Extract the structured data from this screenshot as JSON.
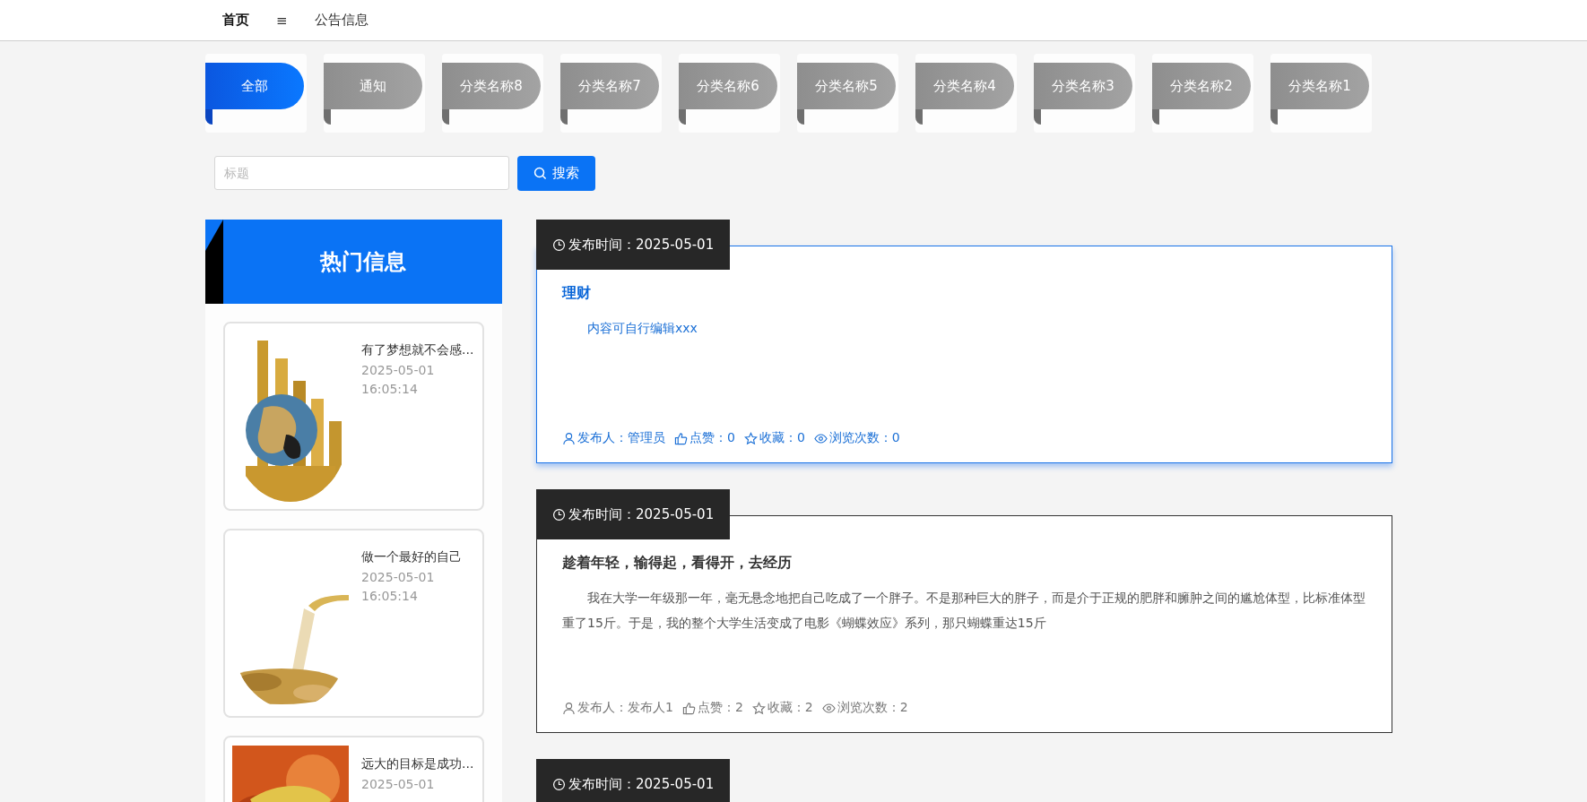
{
  "nav": {
    "items": [
      {
        "label": "首页",
        "selected": true
      },
      {
        "label": "≡",
        "selected": false
      },
      {
        "label": "公告信息",
        "selected": false
      }
    ]
  },
  "categories": [
    {
      "label": "全部",
      "selected": true
    },
    {
      "label": "通知",
      "selected": false
    },
    {
      "label": "分类名称8",
      "selected": false
    },
    {
      "label": "分类名称7",
      "selected": false
    },
    {
      "label": "分类名称6",
      "selected": false
    },
    {
      "label": "分类名称5",
      "selected": false
    },
    {
      "label": "分类名称4",
      "selected": false
    },
    {
      "label": "分类名称3",
      "selected": false
    },
    {
      "label": "分类名称2",
      "selected": false
    },
    {
      "label": "分类名称1",
      "selected": false
    }
  ],
  "search": {
    "placeholder": "标题",
    "button": "搜索"
  },
  "hot": {
    "title": "热门信息",
    "items": [
      {
        "kind": "picture",
        "title": "有了梦想就不会感...",
        "date": "2025-05-01",
        "time": "16:05:14"
      },
      {
        "kind": "picture",
        "title": "做一个最好的自己",
        "date": "2025-05-01",
        "time": "16:05:14"
      },
      {
        "kind": "picture",
        "title": "远大的目标是成功...",
        "date": "2025-05-01"
      }
    ]
  },
  "posts": [
    {
      "date_label": "发布时间：2025-05-01",
      "highlighted": true,
      "title": "理财",
      "body": "内容可自行编辑xxx",
      "meta": [
        {
          "kind": "author",
          "text": "发布人：管理员"
        },
        {
          "kind": "like",
          "text": "点赞：0"
        },
        {
          "kind": "favorite",
          "text": "收藏：0"
        },
        {
          "kind": "views",
          "text": "浏览次数：0"
        }
      ]
    },
    {
      "date_label": "发布时间：2025-05-01",
      "highlighted": false,
      "title": "趁着年轻，输得起，看得开，去经历",
      "body": "我在大学一年级那一年，毫无悬念地把自己吃成了一个胖子。不是那种巨大的胖子，而是介于正规的肥胖和臃肿之间的尴尬体型，比标准体型重了15斤。于是，我的整个大学生活变成了电影《蝴蝶效应》系列，那只蝴蝶重达15斤",
      "meta": [
        {
          "kind": "author",
          "text": "发布人：发布人1"
        },
        {
          "kind": "like",
          "text": "点赞：2"
        },
        {
          "kind": "favorite",
          "text": "收藏：2"
        },
        {
          "kind": "views",
          "text": "浏览次数：2"
        }
      ]
    },
    {
      "date_label": "发布时间：2025-05-01"
    }
  ]
}
